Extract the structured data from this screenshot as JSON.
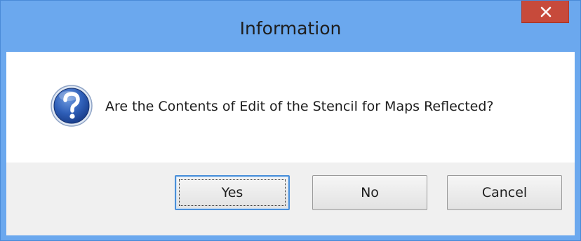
{
  "dialog": {
    "title": "Information",
    "message": "Are the Contents of Edit of the Stencil for Maps Reflected?",
    "icon": "question-icon",
    "close_icon": "close-icon",
    "buttons": {
      "yes_label": "Yes",
      "no_label": "No",
      "cancel_label": "Cancel"
    }
  },
  "colors": {
    "titlebar": "#6ba8ee",
    "close_button": "#c74a3b",
    "content_background": "#ffffff",
    "button_area_background": "#f0f0f0",
    "focused_button_border": "#4a8fd9"
  }
}
